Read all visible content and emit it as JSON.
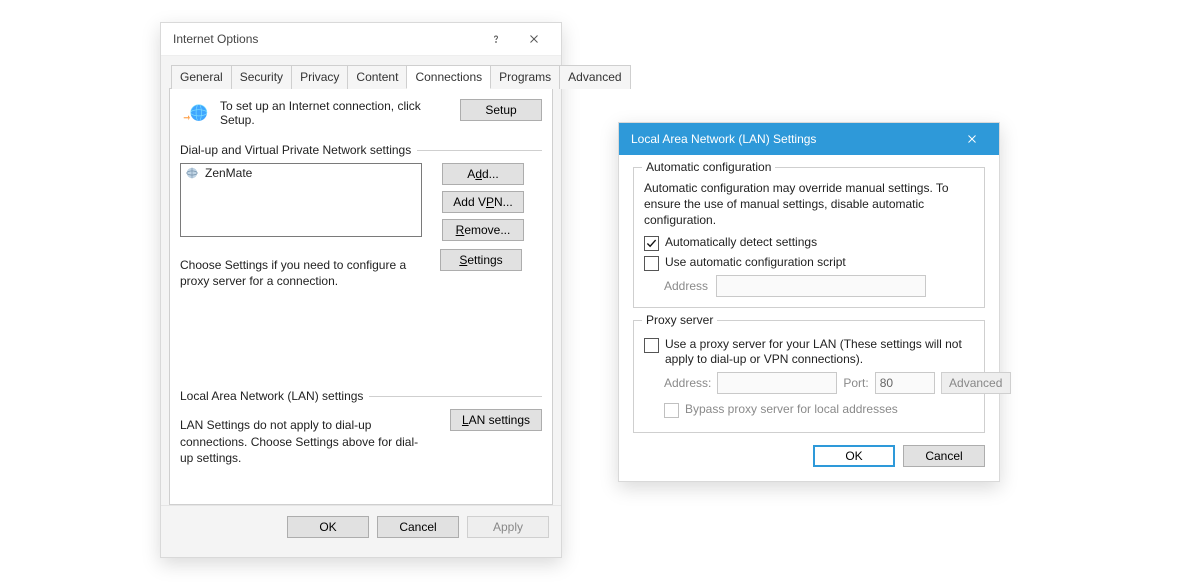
{
  "inetopt": {
    "title": "Internet Options",
    "tabs": [
      "General",
      "Security",
      "Privacy",
      "Content",
      "Connections",
      "Programs",
      "Advanced"
    ],
    "active_tab_index": 4,
    "setup_hint": "To set up an Internet connection, click Setup.",
    "setup_btn": "Setup",
    "dialup_group": "Dial-up and Virtual Private Network settings",
    "connections": [
      {
        "name": "ZenMate"
      }
    ],
    "btn_add": "Add...",
    "btn_add_letter": "d",
    "btn_add_vpn": "Add VPN...",
    "btn_add_vpn_letter": "P",
    "btn_remove": "Remove...",
    "btn_remove_letter": "R",
    "btn_settings": "Settings",
    "btn_settings_letter": "S",
    "choose_note": "Choose Settings if you need to configure a proxy server for a connection.",
    "lan_group": "Local Area Network (LAN) settings",
    "lan_note": "LAN Settings do not apply to dial-up connections. Choose Settings above for dial-up settings.",
    "btn_lan": "LAN settings",
    "btn_lan_letter": "L",
    "ok": "OK",
    "cancel": "Cancel",
    "apply": "Apply"
  },
  "lan": {
    "title": "Local Area Network (LAN) Settings",
    "auto_group": "Automatic configuration",
    "auto_note": "Automatic configuration may override manual settings.  To ensure the use of manual settings, disable automatic configuration.",
    "chk_auto_detect": {
      "label": "Automatically detect settings",
      "checked": true
    },
    "chk_auto_script": {
      "label": "Use automatic configuration script",
      "checked": false
    },
    "address_label": "Address",
    "address_value": "",
    "proxy_group": "Proxy server",
    "chk_proxy": {
      "label": "Use a proxy server for your LAN (These settings will not apply to dial-up or VPN connections).",
      "checked": false
    },
    "proxy_address_label": "Address:",
    "proxy_address_value": "",
    "proxy_port_label": "Port:",
    "proxy_port_value": "80",
    "btn_advanced": "Advanced",
    "chk_bypass": {
      "label": "Bypass proxy server for local addresses",
      "checked": false,
      "disabled": true
    },
    "ok": "OK",
    "cancel": "Cancel"
  }
}
